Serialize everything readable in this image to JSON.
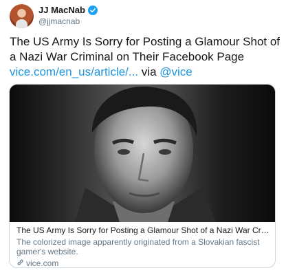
{
  "author": {
    "display_name": "JJ MacNab",
    "handle": "@jjmacnab"
  },
  "tweet": {
    "line1": "The US Army Is Sorry for Posting a Glamour Shot of",
    "line2": "a Nazi War Criminal on Their Facebook Page",
    "link_text": "vice.com/en_us/article/...",
    "via_text": " via ",
    "mention": "@vice"
  },
  "card": {
    "title": "The US Army Is Sorry for Posting a Glamour Shot of a Nazi War Criminal o...",
    "description": "The colorized image apparently originated from a Slovakian fascist gamer's website.",
    "domain": "vice.com"
  },
  "icons": {
    "verified": "verified-badge-icon",
    "link": "link-icon"
  },
  "colors": {
    "link": "#1b95e0",
    "verified": "#1da1f2",
    "secondary_text": "#657786"
  }
}
